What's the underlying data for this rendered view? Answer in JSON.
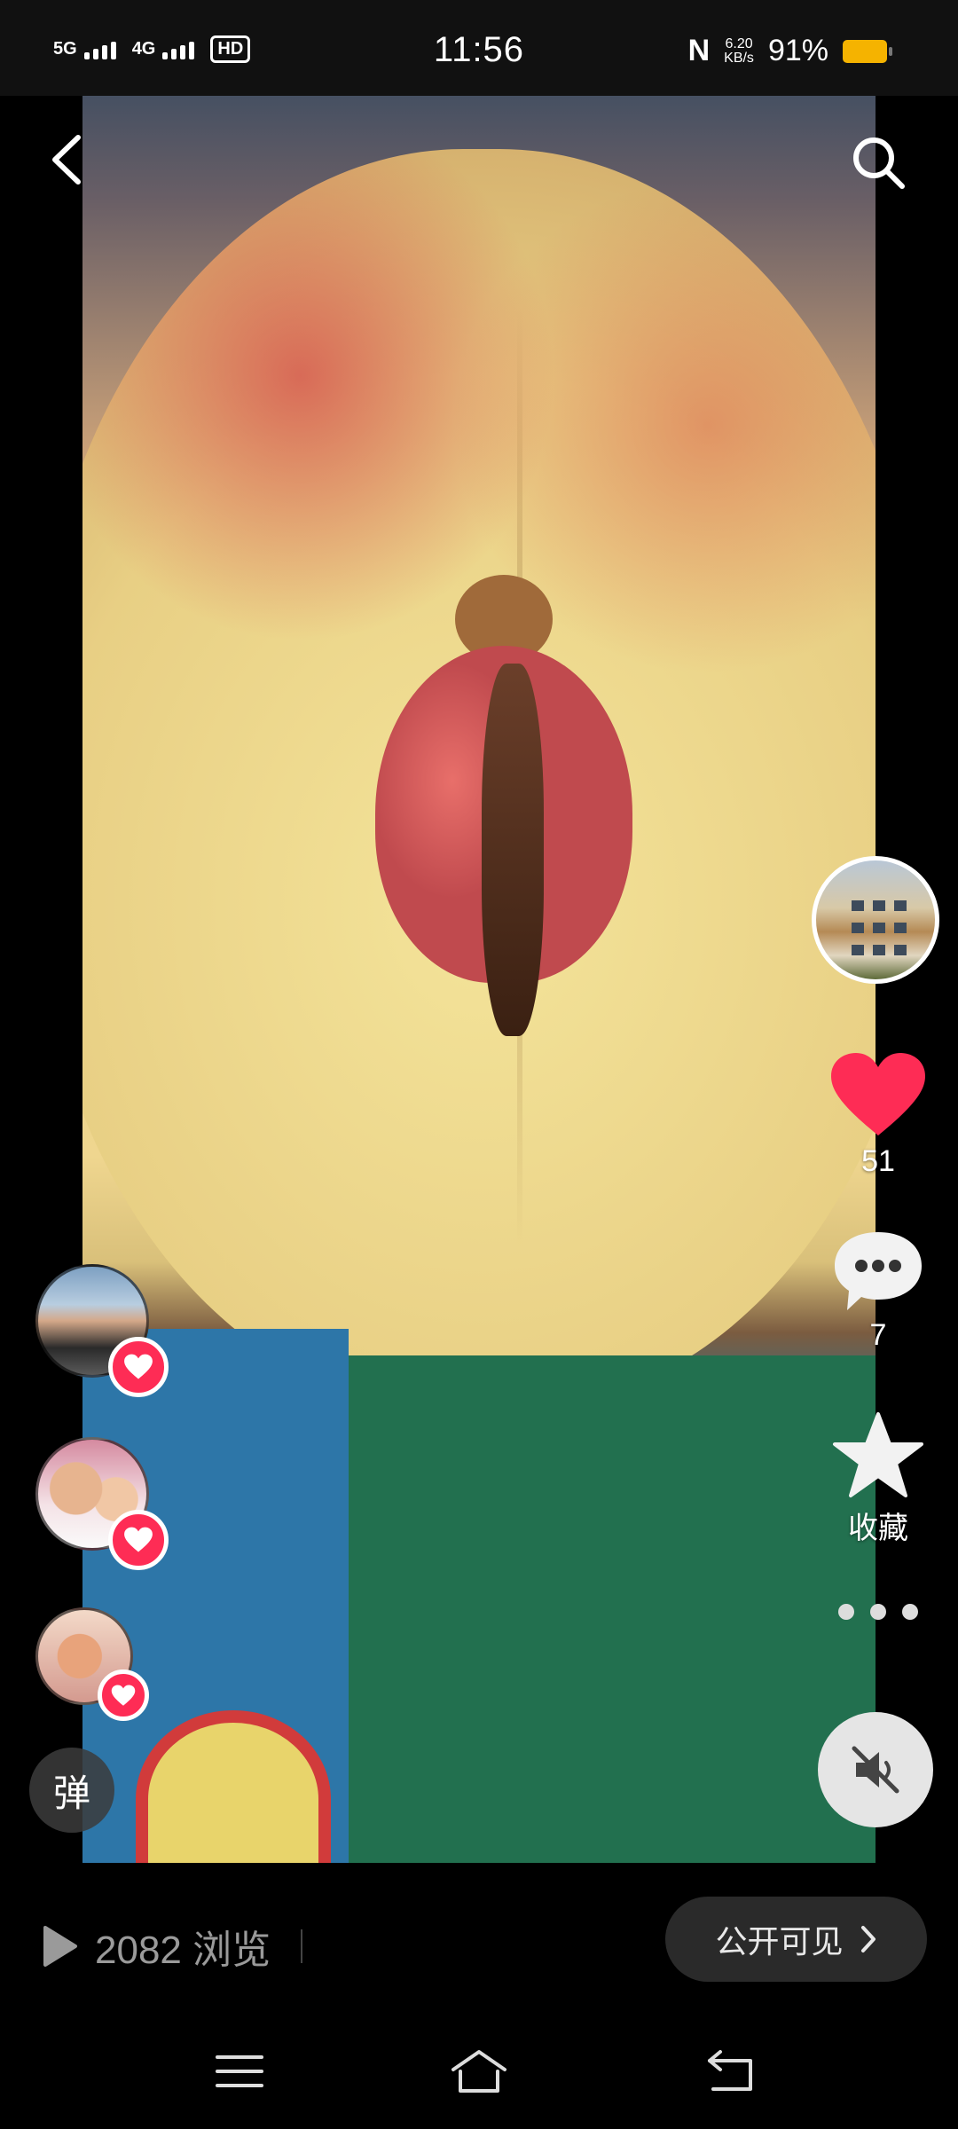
{
  "status_bar": {
    "time": "11:56",
    "signal_1": "5G",
    "signal_2": "4G",
    "hd": "HD",
    "nfc": "N",
    "net_speed_value": "6.20",
    "net_speed_unit": "KB/s",
    "battery_percent": "91%",
    "battery_color": "#f5b300"
  },
  "top_bar": {
    "back_icon": "chevron-left-icon",
    "search_icon": "search-icon"
  },
  "right_rail": {
    "like_count": "51",
    "comment_count": "7",
    "favorite_label": "收藏",
    "like_color": "#fe2c55"
  },
  "left_panel": {
    "danmu_label": "弹"
  },
  "bottom_bar": {
    "view_count": "2082 浏览",
    "visibility_label": "公开可见"
  }
}
